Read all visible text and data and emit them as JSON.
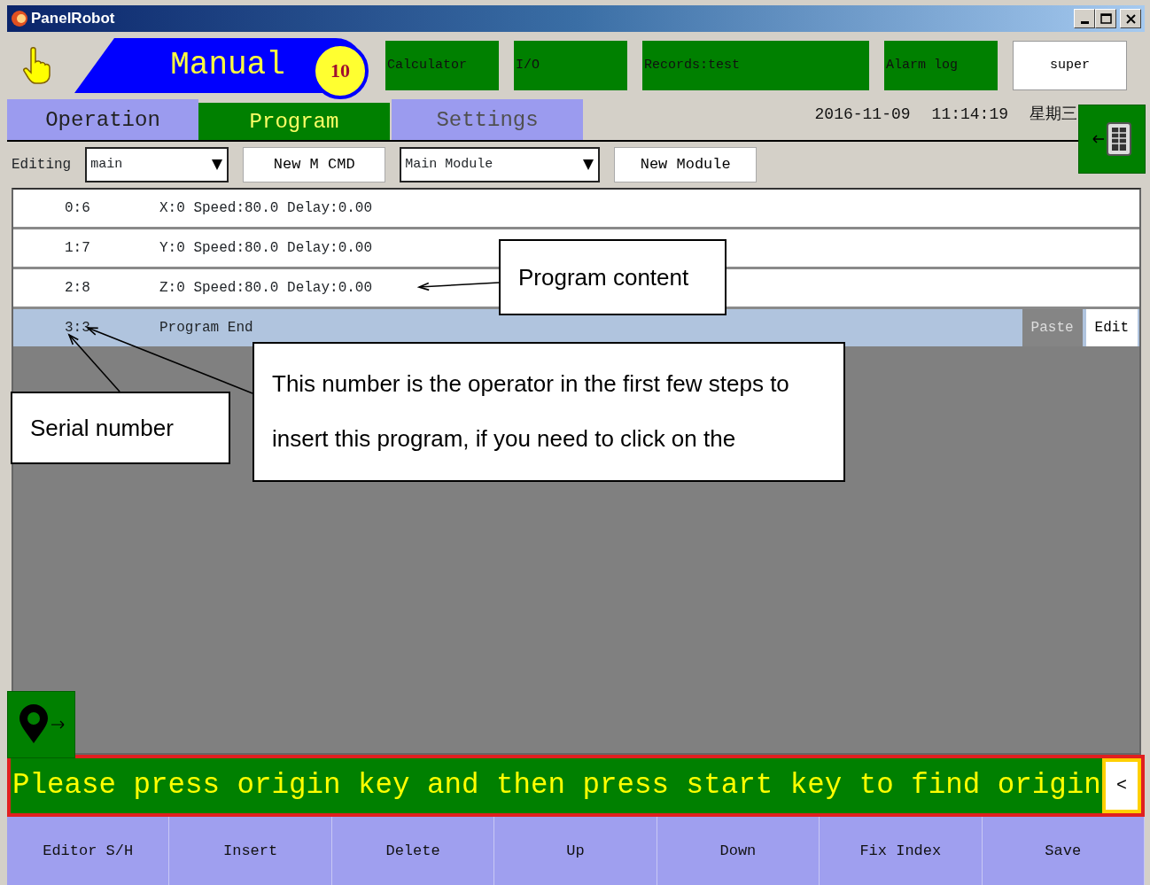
{
  "window": {
    "title": "PanelRobot"
  },
  "mode": {
    "label": "Manual",
    "badge": "10"
  },
  "top_buttons": [
    {
      "label": "Calculator"
    },
    {
      "label": "I/O"
    },
    {
      "label": "Records:test"
    },
    {
      "label": "Alarm log"
    }
  ],
  "user": "super",
  "tabs": [
    {
      "label": "Operation",
      "selected": false,
      "disabled": false
    },
    {
      "label": "Program",
      "selected": true,
      "disabled": false
    },
    {
      "label": "Settings",
      "selected": false,
      "disabled": true
    }
  ],
  "datetime": [
    "2016-11-09",
    "11:14:19",
    "星期三"
  ],
  "editor_toolbar": {
    "label": "Editing",
    "program_select": "main",
    "new_cmd_button": "New M CMD",
    "module_select": "Main Module",
    "new_module_button": "New Module"
  },
  "program_rows": [
    {
      "index": "0:6",
      "command": "X:0 Speed:80.0 Delay:0.00",
      "selected": false
    },
    {
      "index": "1:7",
      "command": "Y:0 Speed:80.0 Delay:0.00",
      "selected": false
    },
    {
      "index": "2:8",
      "command": "Z:0 Speed:80.0 Delay:0.00",
      "selected": false
    },
    {
      "index": "3:3",
      "command": "Program End",
      "selected": true
    }
  ],
  "row_actions": [
    {
      "label": "Paste",
      "disabled": true
    },
    {
      "label": "Edit",
      "disabled": false
    }
  ],
  "message": {
    "text": "Please press origin key and then press start key to find origin",
    "collapse_button": "<"
  },
  "bottom_buttons": [
    "Editor S/H",
    "Insert",
    "Delete",
    "Up",
    "Down",
    "Fix Index",
    "Save"
  ],
  "annotations": [
    {
      "text": "Program content"
    },
    {
      "text": "Serial number"
    },
    {
      "text": "This number is the operator in the first few steps to insert this program, if you need to click on the"
    }
  ]
}
